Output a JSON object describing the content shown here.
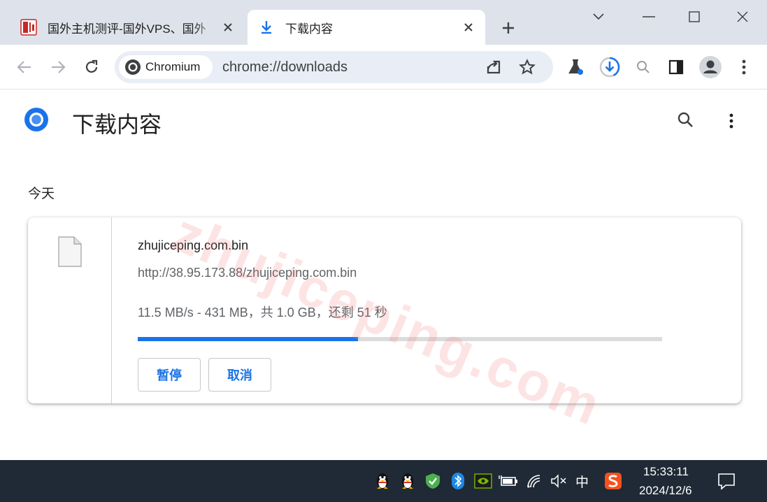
{
  "tabs": [
    {
      "title": "国外主机测评-国外VPS、国外",
      "active": false
    },
    {
      "title": "下载内容",
      "active": true
    }
  ],
  "toolbar": {
    "chip_label": "Chromium",
    "url": "chrome://downloads"
  },
  "page": {
    "title": "下载内容",
    "watermark": "zhujiceping.com",
    "section_date": "今天"
  },
  "download": {
    "file_name": "zhujiceping.com.bin",
    "url": "http://38.95.173.88/zhujiceping.com.bin",
    "status": "11.5 MB/s - 431 MB，共 1.0 GB，还剩 51 秒",
    "progress_fraction": 0.42,
    "pause_label": "暂停",
    "cancel_label": "取消"
  },
  "taskbar": {
    "ime": "中",
    "time": "15:33:11",
    "date": "2024/12/6"
  },
  "colors": {
    "accent": "#1a73e8",
    "tabstrip": "#dee3eb",
    "omnibox": "#e9edf5",
    "taskbar": "#1f2a36"
  }
}
